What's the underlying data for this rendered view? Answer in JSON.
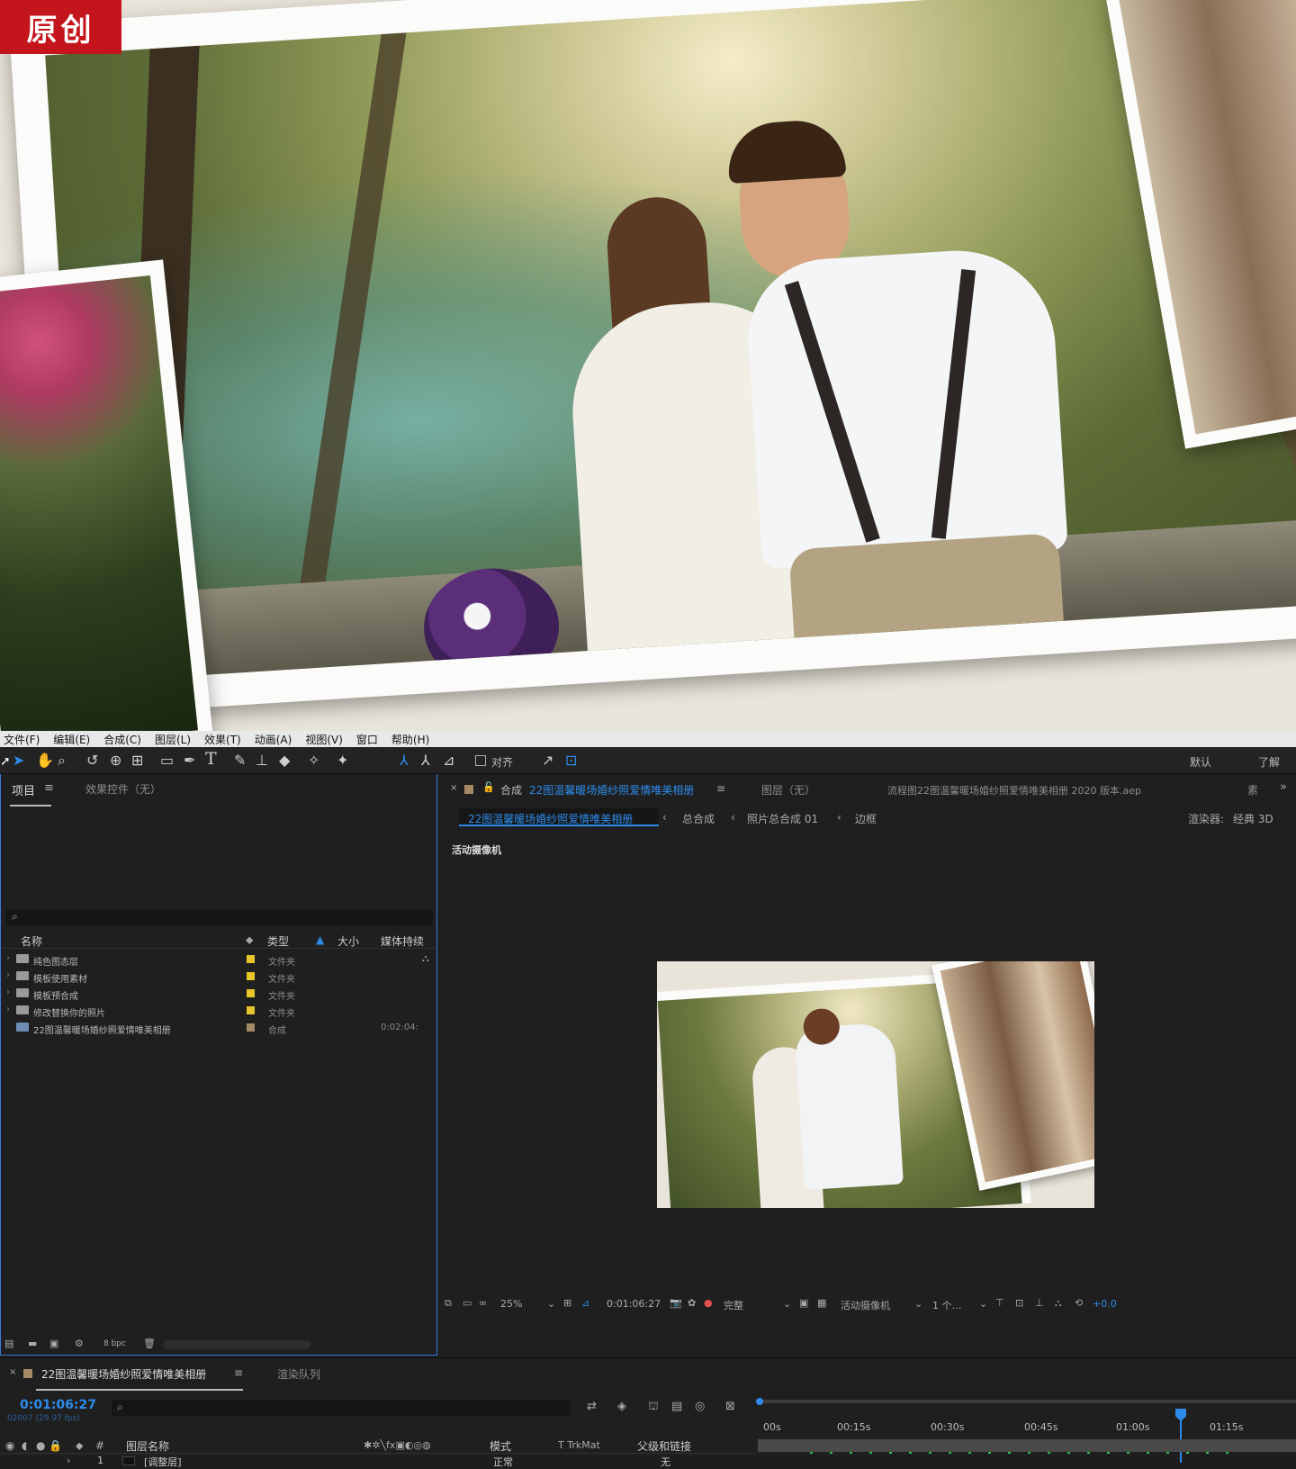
{
  "badge": "原创",
  "menu": [
    "文件(F)",
    "编辑(E)",
    "合成(C)",
    "图层(L)",
    "效果(T)",
    "动画(A)",
    "视图(V)",
    "窗口",
    "帮助(H)"
  ],
  "toolbar": {
    "snap": "对齐",
    "workspace": "默认",
    "learn": "了解"
  },
  "project": {
    "tab": "项目",
    "effects_tab": "效果控件（无）",
    "search_placeholder": "",
    "columns": {
      "name": "名称",
      "type": "类型",
      "size": "大小",
      "duration": "媒体持续"
    },
    "items": [
      {
        "name": "纯色图态层",
        "type": "文件夹",
        "duration": "",
        "label_color": "#e6c62a"
      },
      {
        "name": "模板使用素材",
        "type": "文件夹",
        "duration": "",
        "label_color": "#e6c62a"
      },
      {
        "name": "模板预合成",
        "type": "文件夹",
        "duration": "",
        "label_color": "#e6c62a"
      },
      {
        "name": "修改替换你的照片",
        "type": "文件夹",
        "duration": "",
        "label_color": "#e6c62a"
      },
      {
        "name": "22图温馨暖场婚纱照爱情唯美相册",
        "type": "合成",
        "duration": "0:02:04:",
        "label_color": "#a68a66"
      }
    ],
    "bpc": "8 bpc"
  },
  "comp": {
    "tab_prefix": "合成",
    "name": "22图温馨暖场婚纱照爱情唯美相册",
    "layer_tab": "图层（无）",
    "file": "流程图22图温馨暖场婚纱照爱情唯美相册 2020 版本.aep",
    "more": "素",
    "breadcrumbs": [
      "22图温馨暖场婚纱照爱情唯美相册",
      "总合成",
      "照片总合成 01",
      "边框"
    ],
    "renderer_label": "渲染器:",
    "renderer": "经典 3D",
    "camera_label": "活动摄像机",
    "footer": {
      "zoom": "25%",
      "time": "0:01:06:27",
      "quality": "完整",
      "camera": "活动摄像机",
      "views": "1 个…",
      "exposure": "+0.0"
    }
  },
  "timeline": {
    "tab": "22图温馨暖场婚纱照爱情唯美相册",
    "render_queue": "渲染队列",
    "time": "0:01:06:27",
    "frames": "02007 (29.97 fps)",
    "col_layer": "图层名称",
    "col_mode": "模式",
    "col_trk": "T  TrkMat",
    "col_parent": "父级和链接",
    "ticks": [
      "00s",
      "00:15s",
      "00:30s",
      "00:45s",
      "01:00s",
      "01:15s"
    ],
    "layer": {
      "num": "1",
      "name": "[调整层]",
      "mode": "正常",
      "parent": "无"
    }
  },
  "colors": {
    "accent": "#2d8ceb",
    "badge": "#c4151c",
    "panel": "#1f1f1f",
    "folder_label": "#e6c62a"
  }
}
